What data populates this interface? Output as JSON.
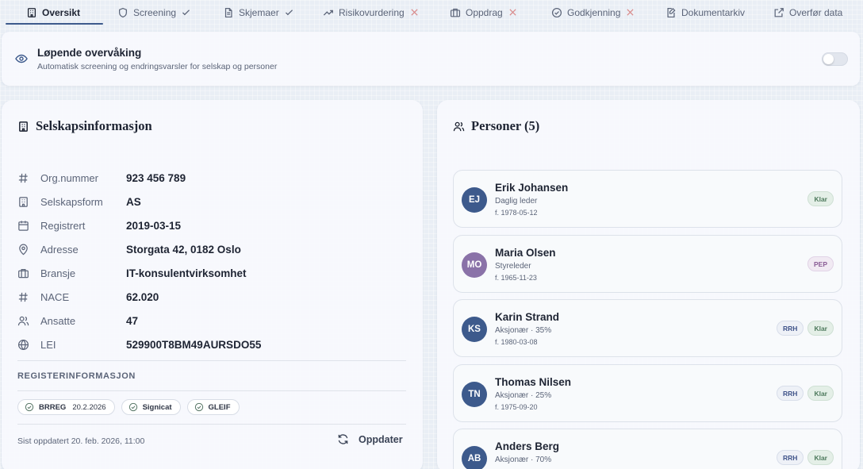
{
  "tabs": [
    {
      "label": "Oversikt",
      "icon": "building-icon",
      "status": "none",
      "active": true
    },
    {
      "label": "Screening",
      "icon": "shield-icon",
      "status": "ok",
      "active": false
    },
    {
      "label": "Skjemaer",
      "icon": "form-icon",
      "status": "ok",
      "active": false
    },
    {
      "label": "Risikovurdering",
      "icon": "trend-icon",
      "status": "missing",
      "active": false
    },
    {
      "label": "Oppdrag",
      "icon": "briefcase-icon",
      "status": "missing",
      "active": false
    },
    {
      "label": "Godkjenning",
      "icon": "check-circle-icon",
      "status": "missing",
      "active": false
    },
    {
      "label": "Dokumentarkiv",
      "icon": "document-icon",
      "status": "none",
      "active": false
    },
    {
      "label": "Overfør data",
      "icon": "external-link-icon",
      "status": "none",
      "active": false
    }
  ],
  "monitoring": {
    "title": "Løpende overvåking",
    "subtitle": "Automatisk screening og endringsvarsler for selskap og personer",
    "enabled": false
  },
  "company": {
    "title": "Selskapsinformasjon",
    "rows": [
      {
        "label": "Org.nummer",
        "value": "923 456 789",
        "icon": "hash-icon"
      },
      {
        "label": "Selskapsform",
        "value": "AS",
        "icon": "building-icon"
      },
      {
        "label": "Registrert",
        "value": "2019-03-15",
        "icon": "calendar-icon"
      },
      {
        "label": "Adresse",
        "value": "Storgata 42, 0182 Oslo",
        "icon": "map-pin-icon"
      },
      {
        "label": "Bransje",
        "value": "IT-konsulentvirksomhet",
        "icon": "briefcase-icon"
      },
      {
        "label": "NACE",
        "value": "62.020",
        "icon": "hash-icon"
      },
      {
        "label": "Ansatte",
        "value": "47",
        "icon": "users-icon"
      },
      {
        "label": "LEI",
        "value": "529900T8BM49AURSDO55",
        "icon": "globe-icon"
      }
    ],
    "registry_heading": "REGISTERINFORMASJON",
    "sources": [
      {
        "label": "BRREG",
        "date": "20.2.2026"
      },
      {
        "label": "Signicat",
        "date": ""
      },
      {
        "label": "GLEIF",
        "date": ""
      }
    ],
    "last_updated": "Sist oppdatert 20. feb. 2026, 11:00",
    "refresh_label": "Oppdater"
  },
  "persons": {
    "title": "Personer (5)",
    "items": [
      {
        "initials": "EJ",
        "name": "Erik Johansen",
        "role": "Daglig leder",
        "born": "f. 1978-05-12",
        "avatar_color": "#3d5a8c",
        "badges": [
          "Klar"
        ]
      },
      {
        "initials": "MO",
        "name": "Maria Olsen",
        "role": "Styreleder",
        "born": "f. 1965-11-23",
        "avatar_color": "#8a72a8",
        "badges": [
          "PEP"
        ]
      },
      {
        "initials": "KS",
        "name": "Karin Strand",
        "role": "Aksjonær · 35%",
        "born": "f. 1980-03-08",
        "avatar_color": "#3d5a8c",
        "badges": [
          "RRH",
          "Klar"
        ]
      },
      {
        "initials": "TN",
        "name": "Thomas Nilsen",
        "role": "Aksjonær · 25%",
        "born": "f. 1975-09-20",
        "avatar_color": "#3d5a8c",
        "badges": [
          "RRH",
          "Klar"
        ]
      },
      {
        "initials": "AB",
        "name": "Anders Berg",
        "role": "Aksjonær · 70%",
        "born": "",
        "avatar_color": "#3d5a8c",
        "badges": [
          "RRH",
          "Klar"
        ]
      }
    ]
  }
}
